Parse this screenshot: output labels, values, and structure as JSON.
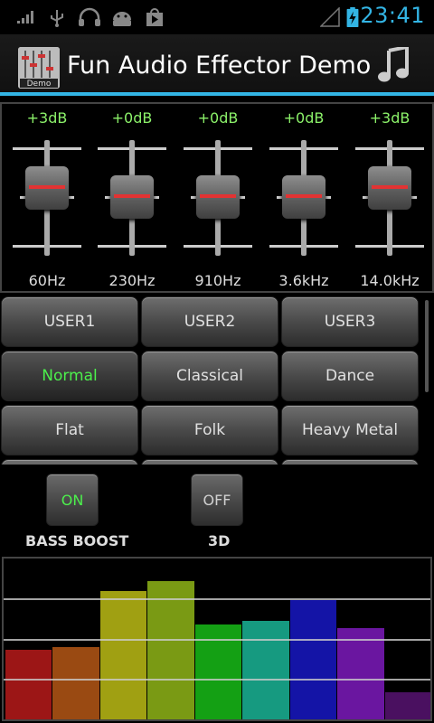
{
  "status_bar": {
    "time": "23:41",
    "icons": [
      "signal-bars-icon",
      "usb-icon",
      "headphones-icon",
      "android-icon",
      "play-store-icon",
      "no-signal-icon",
      "battery-charging-icon"
    ]
  },
  "action_bar": {
    "app_icon_label": "Demo",
    "title": "Fun Audio Effector Demo",
    "menu_icon": "music-note-icon"
  },
  "equalizer": {
    "bands": [
      {
        "gain": "+3dB",
        "freq": "60Hz",
        "level_db": 3
      },
      {
        "gain": "+0dB",
        "freq": "230Hz",
        "level_db": 0
      },
      {
        "gain": "+0dB",
        "freq": "910Hz",
        "level_db": 0
      },
      {
        "gain": "+0dB",
        "freq": "3.6kHz",
        "level_db": 0
      },
      {
        "gain": "+3dB",
        "freq": "14.0kHz",
        "level_db": 3
      }
    ]
  },
  "presets": {
    "buttons": [
      {
        "label": "USER1",
        "active": false
      },
      {
        "label": "USER2",
        "active": false
      },
      {
        "label": "USER3",
        "active": false
      },
      {
        "label": "Normal",
        "active": true
      },
      {
        "label": "Classical",
        "active": false
      },
      {
        "label": "Dance",
        "active": false
      },
      {
        "label": "Flat",
        "active": false
      },
      {
        "label": "Folk",
        "active": false
      },
      {
        "label": "Heavy Metal",
        "active": false
      }
    ]
  },
  "effects": {
    "bass_boost": {
      "state": "ON",
      "label": "BASS BOOST",
      "on_color": "#4cf04c"
    },
    "virtualizer_3d": {
      "state": "OFF",
      "label": "3D",
      "off_color": "#d0d0d0"
    }
  },
  "visualizer": {
    "levels": [
      0.43,
      0.45,
      0.8,
      0.86,
      0.59,
      0.61,
      0.74,
      0.57,
      0.17
    ],
    "colors": [
      "#9c1616",
      "#9a4a12",
      "#a0a012",
      "#7a9a14",
      "#14a014",
      "#169a80",
      "#1414a6",
      "#6a16a0",
      "#4a1060"
    ]
  },
  "colors": {
    "accent": "#33b5e5",
    "gain_text": "#8cf26a",
    "active_preset": "#4cf04c"
  }
}
